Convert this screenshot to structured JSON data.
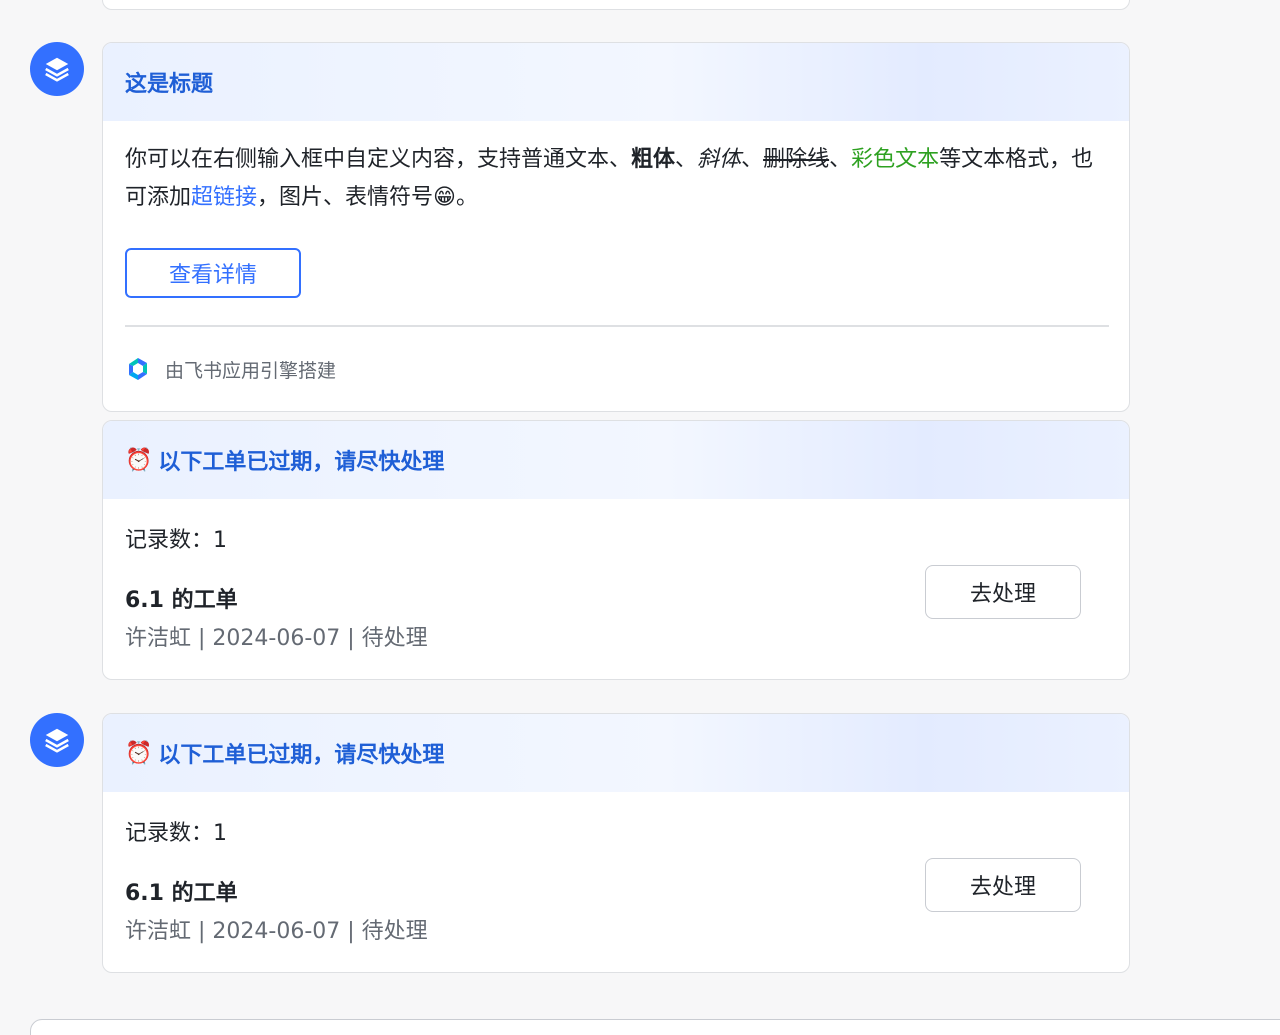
{
  "card1": {
    "title": "这是标题",
    "body": {
      "t1": "你可以在右侧输入框中自定义内容，支持普通文本、",
      "bold": "粗体",
      "sep1": "、",
      "italic": "斜体",
      "sep2": "、",
      "strike": "删除线",
      "sep3": "、",
      "green": "彩色文本",
      "t2": "等文本格式，也可添加",
      "link": "超链接",
      "t3": "，图片、表情符号😁。"
    },
    "button_label": "查看详情",
    "footer_text": "由飞书应用引擎搭建"
  },
  "card2": {
    "emoji": "⏰",
    "title": "以下工单已过期，请尽快处理",
    "records_label": "记录数：1",
    "ticket_title": "6.1 的工单",
    "ticket_meta": "许洁虹 | 2024-06-07 | 待处理",
    "button_label": "去处理"
  },
  "card3": {
    "emoji": "⏰",
    "title": "以下工单已过期，请尽快处理",
    "records_label": "记录数：1",
    "ticket_title": "6.1 的工单",
    "ticket_meta": "许洁虹 | 2024-06-07 | 待处理",
    "button_label": "去处理"
  },
  "colors": {
    "accent": "#3370ff",
    "header_title": "#1f5fd6",
    "green_text": "#2ea121",
    "muted": "#646a73"
  },
  "icons": {
    "avatar": "layers-icon",
    "footer_logo": "feishu-app-engine-logo",
    "alarm": "alarm-clock-emoji"
  }
}
